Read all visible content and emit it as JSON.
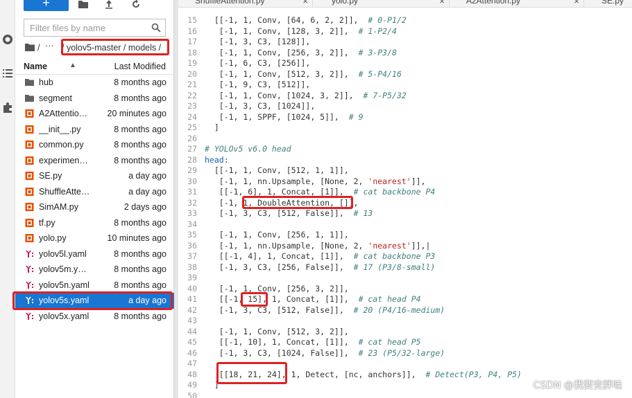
{
  "toolbar": {
    "new_label": "+"
  },
  "filter": {
    "placeholder": "Filter files by name"
  },
  "breadcrumb": {
    "root": "/",
    "ellipsis": "···",
    "path": "/ yolov5-master / models /"
  },
  "list_header": {
    "name": "Name",
    "sort_indicator": "▲",
    "modified": "Last Modified"
  },
  "files": [
    {
      "name": "hub",
      "modified": "8 months ago",
      "icon": "folder-icon",
      "color": "#616161"
    },
    {
      "name": "segment",
      "modified": "8 months ago",
      "icon": "folder-icon",
      "color": "#616161"
    },
    {
      "name": "A2Attentio…",
      "modified": "20 minutes ago",
      "icon": "python-file-icon",
      "color": "#e65100"
    },
    {
      "name": "__init__.py",
      "modified": "8 months ago",
      "icon": "python-file-icon",
      "color": "#e65100"
    },
    {
      "name": "common.py",
      "modified": "8 months ago",
      "icon": "python-file-icon",
      "color": "#e65100"
    },
    {
      "name": "experimen…",
      "modified": "8 months ago",
      "icon": "python-file-icon",
      "color": "#e65100"
    },
    {
      "name": "SE.py",
      "modified": "a day ago",
      "icon": "python-file-icon",
      "color": "#e65100"
    },
    {
      "name": "ShuffleAtte…",
      "modified": "a day ago",
      "icon": "python-file-icon",
      "color": "#e65100"
    },
    {
      "name": "SimAM.py",
      "modified": "2 days ago",
      "icon": "python-file-icon",
      "color": "#e65100"
    },
    {
      "name": "tf.py",
      "modified": "8 months ago",
      "icon": "python-file-icon",
      "color": "#e65100"
    },
    {
      "name": "yolo.py",
      "modified": "10 minutes ago",
      "icon": "python-file-icon",
      "color": "#e65100"
    },
    {
      "name": "yolov5l.yaml",
      "modified": "8 months ago",
      "icon": "yaml-file-icon",
      "color": "#c2185b"
    },
    {
      "name": "yolov5m.y…",
      "modified": "8 months ago",
      "icon": "yaml-file-icon",
      "color": "#c2185b"
    },
    {
      "name": "yolov5n.yaml",
      "modified": "8 months ago",
      "icon": "yaml-file-icon",
      "color": "#c2185b"
    },
    {
      "name": "yolov5s.yaml",
      "modified": "a day ago",
      "icon": "yaml-file-icon",
      "color": "#ffffff",
      "selected": true
    },
    {
      "name": "yolov5x.yaml",
      "modified": "8 months ago",
      "icon": "yaml-file-icon",
      "color": "#c2185b"
    }
  ],
  "tabs": [
    {
      "label": "ShuffleAttention.py",
      "close": "×"
    },
    {
      "label": "yolo.py",
      "close": "×"
    },
    {
      "label": "A2Attention.py",
      "close": "×"
    },
    {
      "label": "SE.py",
      "close": ""
    }
  ],
  "code": [
    {
      "n": "15",
      "t": "  [[-1, 1, Conv, [64, 6, 2, 2]],  # 0-P1/2"
    },
    {
      "n": "16",
      "t": "   [-1, 1, Conv, [128, 3, 2]],  # 1-P2/4"
    },
    {
      "n": "17",
      "t": "   [-1, 3, C3, [128]],"
    },
    {
      "n": "18",
      "t": "   [-1, 1, Conv, [256, 3, 2]],  # 3-P3/8"
    },
    {
      "n": "19",
      "t": "   [-1, 6, C3, [256]],"
    },
    {
      "n": "20",
      "t": "   [-1, 1, Conv, [512, 3, 2]],  # 5-P4/16"
    },
    {
      "n": "21",
      "t": "   [-1, 9, C3, [512]],"
    },
    {
      "n": "22",
      "t": "   [-1, 1, Conv, [1024, 3, 2]],  # 7-P5/32"
    },
    {
      "n": "23",
      "t": "   [-1, 3, C3, [1024]],"
    },
    {
      "n": "24",
      "t": "   [-1, 1, SPPF, [1024, 5]],  # 9"
    },
    {
      "n": "25",
      "t": "  ]"
    },
    {
      "n": "26",
      "t": ""
    },
    {
      "n": "27",
      "t": "# YOLOv5 v6.0 head",
      "kind": "cm"
    },
    {
      "n": "28",
      "t": "head:",
      "kind": "kw"
    },
    {
      "n": "29",
      "t": "  [[-1, 1, Conv, [512, 1, 1]],"
    },
    {
      "n": "30",
      "t": "   [-1, 1, nn.Upsample, [None, 2, 'nearest']],"
    },
    {
      "n": "31",
      "t": "   [[-1, 6], 1, Concat, [1]],  # cat backbone P4"
    },
    {
      "n": "32",
      "t": "   [-1, 1, DoubleAttention, []],"
    },
    {
      "n": "33",
      "t": "   [-1, 3, C3, [512, False]],  # 13"
    },
    {
      "n": "34",
      "t": ""
    },
    {
      "n": "35",
      "t": "   [-1, 1, Conv, [256, 1, 1]],"
    },
    {
      "n": "36",
      "t": "   [-1, 1, nn.Upsample, [None, 2, 'nearest']],|"
    },
    {
      "n": "37",
      "t": "   [[-1, 4], 1, Concat, [1]],  # cat backbone P3"
    },
    {
      "n": "38",
      "t": "   [-1, 3, C3, [256, False]],  # 17 (P3/8-small)"
    },
    {
      "n": "39",
      "t": ""
    },
    {
      "n": "40",
      "t": "   [-1, 1, Conv, [256, 3, 2]],"
    },
    {
      "n": "41",
      "t": "   [[-1, 15], 1, Concat, [1]],  # cat head P4"
    },
    {
      "n": "42",
      "t": "   [-1, 3, C3, [512, False]],  # 20 (P4/16-medium)"
    },
    {
      "n": "43",
      "t": ""
    },
    {
      "n": "44",
      "t": "   [-1, 1, Conv, [512, 3, 2]],"
    },
    {
      "n": "45",
      "t": "   [[-1, 10], 1, Concat, [1]],  # cat head P5"
    },
    {
      "n": "46",
      "t": "   [-1, 3, C3, [1024, False]],  # 23 (P5/32-large)"
    },
    {
      "n": "47",
      "t": ""
    },
    {
      "n": "48",
      "t": "   [[18, 21, 24], 1, Detect, [nc, anchors]],  # Detect(P3, P4, P5)"
    },
    {
      "n": "49",
      "t": "  ]"
    },
    {
      "n": "50",
      "t": ""
    }
  ],
  "watermark": "CSDN @我要变胖哇",
  "colors": {
    "accent": "#1976d2",
    "highlight": "#e02020"
  }
}
